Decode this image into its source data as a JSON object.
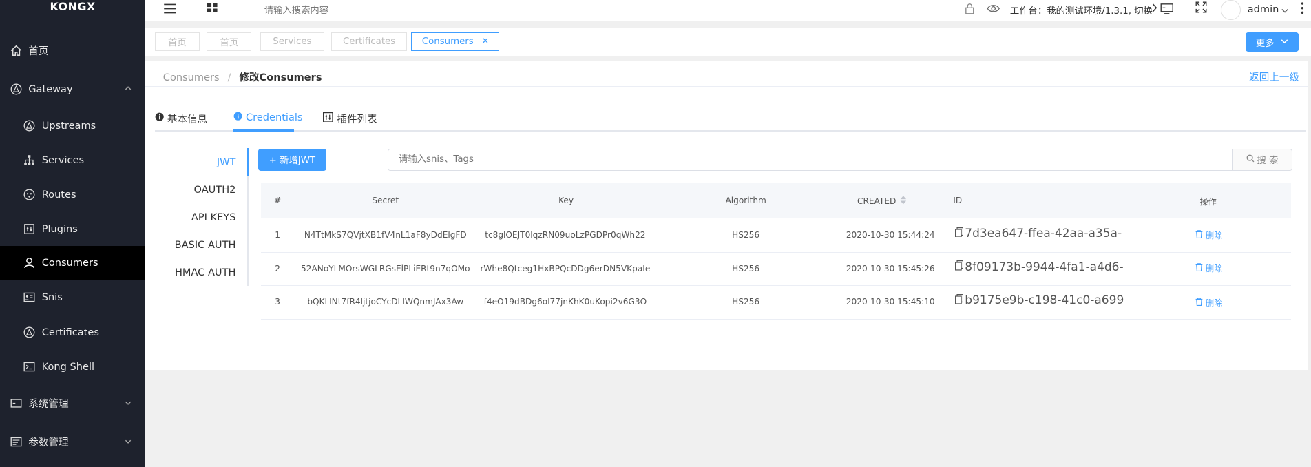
{
  "sidebar": {
    "logo": "KONGX",
    "items": [
      {
        "label": "首页"
      },
      {
        "label": "Gateway"
      },
      {
        "label": "Upstreams"
      },
      {
        "label": "Services"
      },
      {
        "label": "Routes"
      },
      {
        "label": "Plugins"
      },
      {
        "label": "Consumers"
      },
      {
        "label": "Snis"
      },
      {
        "label": "Certificates"
      },
      {
        "label": "Kong Shell"
      },
      {
        "label": "系统管理"
      },
      {
        "label": "参数管理"
      }
    ]
  },
  "topbar": {
    "search_placeholder": "请输入搜索内容",
    "workspace": "工作台：我的测试环境/1.3.1, 切换",
    "user": "admin"
  },
  "tabs": [
    {
      "label": "首页"
    },
    {
      "label": "首页"
    },
    {
      "label": "Services"
    },
    {
      "label": "Certificates"
    },
    {
      "label": "Consumers"
    }
  ],
  "more_button": "更多",
  "breadcrumb": {
    "parent": "Consumers",
    "separator": "/",
    "current": "修改Consumers"
  },
  "back_link": "返回上一级",
  "subtabs": [
    {
      "label": "基本信息"
    },
    {
      "label": "Credentials"
    },
    {
      "label": "插件列表"
    }
  ],
  "cred_types": [
    "JWT",
    "OAUTH2",
    "API KEYS",
    "BASIC AUTH",
    "HMAC AUTH"
  ],
  "add_button": "+ 新增JWT",
  "filter": {
    "placeholder": "请输入snis、Tags",
    "search_label": "搜 索"
  },
  "table": {
    "headers": [
      "#",
      "Secret",
      "Key",
      "Algorithm",
      "CREATED",
      "ID",
      "操作"
    ],
    "rows": [
      {
        "index": "1",
        "secret": "N4TtMkS7QVjtXB1fV4nL1aF8yDdElgFD",
        "key": "tc8glOEJT0lqzRN09uoLzPGDPr0qWh22",
        "algorithm": "HS256",
        "created": "2020-10-30 15:44:24",
        "id": "7d3ea647-ffea-42aa-a35a-",
        "action": "删除"
      },
      {
        "index": "2",
        "secret": "52ANoYLMOrsWGLRGsElPLiERt9n7qOMo",
        "key": "rWhe8Qtceg1HxBPQcDDg6erDN5VKpaIe",
        "algorithm": "HS256",
        "created": "2020-10-30 15:45:26",
        "id": "8f09173b-9944-4fa1-a4d6-",
        "action": "删除"
      },
      {
        "index": "3",
        "secret": "bQKLlNt7fR4ljtjoCYcDLIWQnmJAx3Aw",
        "key": "f4eO19dBDg6ol77jnKhK0uKopi2v6G3O",
        "algorithm": "HS256",
        "created": "2020-10-30 15:45:10",
        "id": "b9175e9b-c198-41c0-a699",
        "action": "删除"
      }
    ]
  },
  "colors": {
    "accent": "#409eff",
    "sidebar": "#1e222d",
    "sidebar_active": "#000000"
  }
}
